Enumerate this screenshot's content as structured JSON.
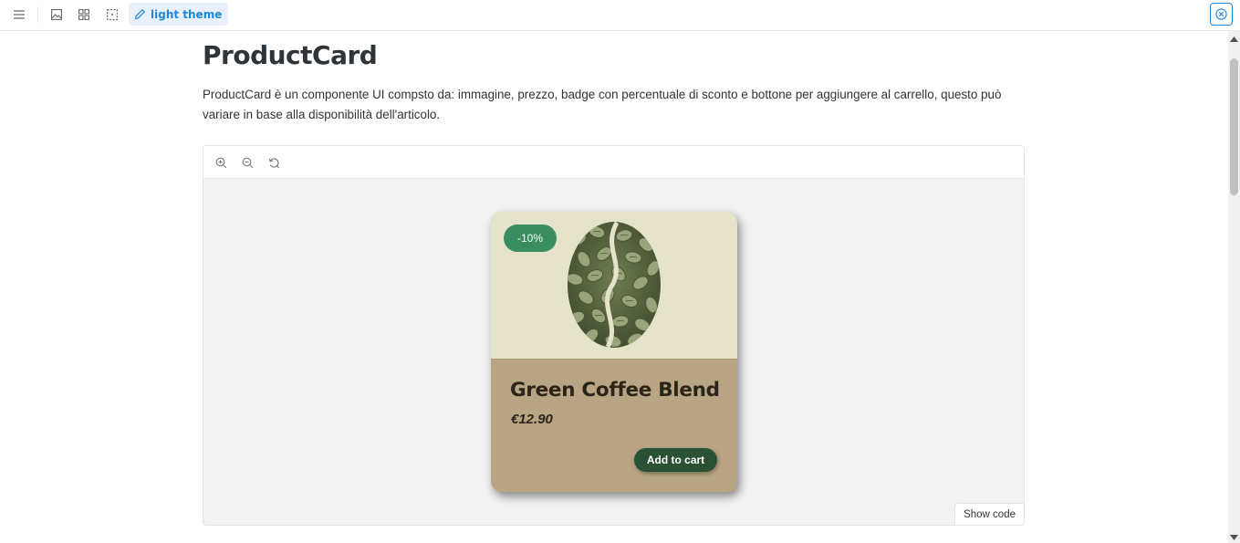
{
  "toolbar": {
    "theme_label": "light theme",
    "icons": [
      "menu-icon",
      "image-icon",
      "grid-icon",
      "frame-icon",
      "pencil-icon",
      "close-circle-icon"
    ]
  },
  "doc": {
    "title": "ProductCard",
    "description": "ProductCard è un componente UI compsto da: immagine, prezzo, badge con percentuale di sconto e bottone per aggiungere al carrello, questo può variare in base alla disponibilità dell'articolo."
  },
  "preview": {
    "tools": [
      "zoom-in-icon",
      "zoom-out-icon",
      "reset-zoom-icon"
    ],
    "show_code_label": "Show code"
  },
  "card": {
    "badge": "-10%",
    "name": "Green Coffee Blend",
    "price": "€12.90",
    "button_label": "Add to cart",
    "colors": {
      "image_bg": "#e6e3cb",
      "body_bg": "#b9a583",
      "badge_bg": "#3a8d5f",
      "button_bg": "#2b5134"
    }
  },
  "colors": {
    "accent": "#1e88d6",
    "title": "#2e3438"
  }
}
